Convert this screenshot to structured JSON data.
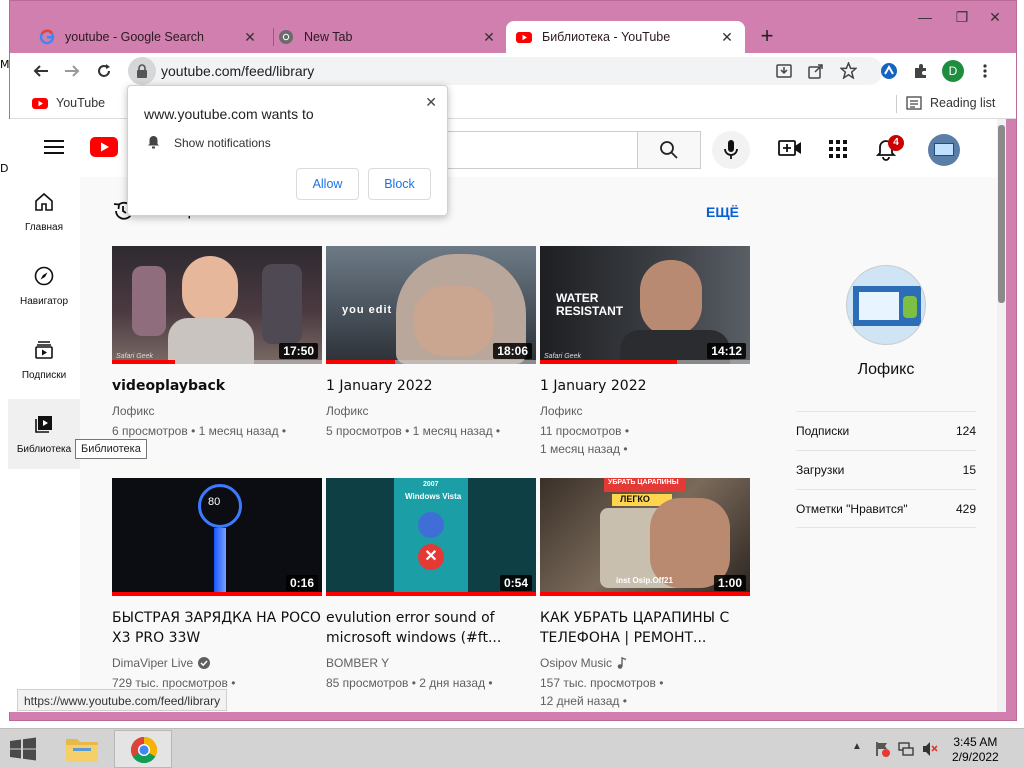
{
  "desktop": {
    "fragment_a": "M",
    "fragment_b": "D"
  },
  "browser": {
    "tabs": [
      {
        "title": "youtube - Google Search",
        "icon": "google-icon"
      },
      {
        "title": "New Tab",
        "icon": "chrome-icon"
      },
      {
        "title": "Библиотека - YouTube",
        "icon": "youtube-icon",
        "active": true
      }
    ],
    "url": "youtube.com/feed/library",
    "profile_initial": "D",
    "bookmarks": [
      {
        "label": "YouTube",
        "icon": "youtube-icon"
      }
    ],
    "reading_list": "Reading list",
    "status_url": "https://www.youtube.com/feed/library",
    "colors": {
      "frame": "#d17fae",
      "accent": "#1a73e8"
    }
  },
  "popup": {
    "title": "www.youtube.com wants to",
    "permission": "Show notifications",
    "allow": "Allow",
    "block": "Block"
  },
  "youtube": {
    "notification_count": "4",
    "sidebar": [
      {
        "label": "Главная",
        "icon": "home-icon"
      },
      {
        "label": "Навигатор",
        "icon": "compass-icon"
      },
      {
        "label": "Подписки",
        "icon": "subscriptions-icon"
      },
      {
        "label": "Библиотека",
        "icon": "library-icon",
        "active": true
      }
    ],
    "tooltip": "Библиотека",
    "section": {
      "title": "История",
      "more": "ЕЩЁ"
    },
    "videos": [
      {
        "title": "videoplayback",
        "channel": "Лофикс",
        "views": "6 просмотров",
        "age": "1 месяц назад",
        "duration": "17:50",
        "progress": 0.3
      },
      {
        "title": "1 January 2022",
        "channel": "Лофикс",
        "views": "5 просмотров",
        "age": "1 месяц назад",
        "duration": "18:06",
        "progress": 0.33
      },
      {
        "title": "1 January 2022",
        "channel": "Лофикс",
        "views": "11 просмотров",
        "age": "1 месяц назад",
        "duration": "14:12",
        "progress": 0.65
      },
      {
        "title": "БЫСТРАЯ ЗАРЯДКА НА POCO X3 PRO 33W",
        "channel": "DimaViper Live",
        "verified": true,
        "views": "729 тыс. просмотров",
        "age": "",
        "duration": "0:16",
        "progress": 1.0
      },
      {
        "title": "evulution error sound of microsoft windows (#ft...",
        "channel": "BOMBER Y",
        "views": "85 просмотров",
        "age": "2 дня назад",
        "duration": "0:54",
        "progress": 1.0
      },
      {
        "title": "КАК УБРАТЬ ЦАРАПИНЫ С ТЕЛЕФОНА | РЕМОНТ...",
        "channel": "Osipov Music",
        "music": true,
        "views": "157 тыс. просмотров",
        "age": "12 дней назад",
        "duration": "1:00",
        "progress": 1.0
      }
    ],
    "thumb_texts": {
      "t1_tag": "Safari Geek",
      "t2_caption": "you edit",
      "t3_line1": "WATER",
      "t3_line2": "RESISTANT",
      "t3_tag": "Safari Geek",
      "t4_percent": "80",
      "t5_line1": "2007",
      "t5_line2": "Windows Vista",
      "t6_top": "УБРАТЬ ЦАРАПИНЫ",
      "t6_mid": "ЛЕГКО",
      "t6_tag": "inst Osip.Off21"
    },
    "profile": {
      "name": "Лофикс",
      "stats": [
        {
          "label": "Подписки",
          "value": "124"
        },
        {
          "label": "Загрузки",
          "value": "15"
        },
        {
          "label": "Отметки \"Нравится\"",
          "value": "429"
        }
      ]
    }
  },
  "taskbar": {
    "time": "3:45 AM",
    "date": "2/9/2022"
  }
}
